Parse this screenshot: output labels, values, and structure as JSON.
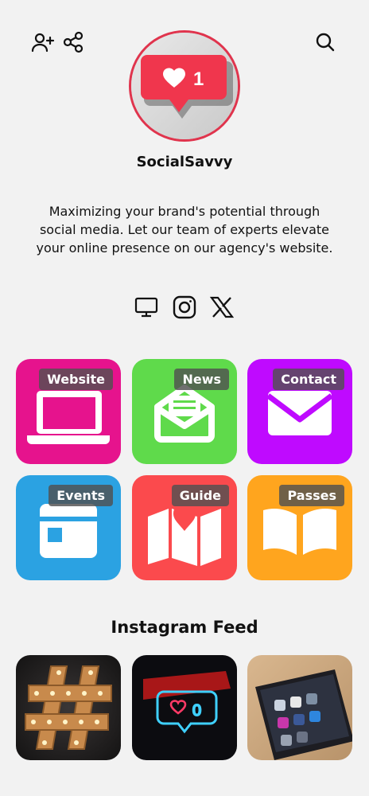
{
  "header": {
    "add_user_icon": "user-plus-icon",
    "share_icon": "share-icon",
    "search_icon": "search-icon"
  },
  "profile": {
    "avatar_badge_count": "1",
    "name": "SocialSavvy",
    "bio": "Maximizing your brand's potential through social media. Let our team of experts elevate your online presence on our agency's website."
  },
  "socials": [
    {
      "icon": "monitor-icon"
    },
    {
      "icon": "instagram-icon"
    },
    {
      "icon": "x-icon"
    }
  ],
  "tiles": [
    {
      "label": "Website",
      "color": "#e6138d",
      "icon": "laptop-icon"
    },
    {
      "label": "News",
      "color": "#5fda4b",
      "icon": "mail-open-icon"
    },
    {
      "label": "Contact",
      "color": "#bf0aff",
      "icon": "envelope-icon"
    },
    {
      "label": "Events",
      "color": "#2ba2e2",
      "icon": "calendar-icon"
    },
    {
      "label": "Guide",
      "color": "#fb4a4d",
      "icon": "map-icon"
    },
    {
      "label": "Passes",
      "color": "#ffa51e",
      "icon": "book-icon"
    }
  ],
  "feed": {
    "title": "Instagram Feed",
    "neon_count": "0"
  }
}
